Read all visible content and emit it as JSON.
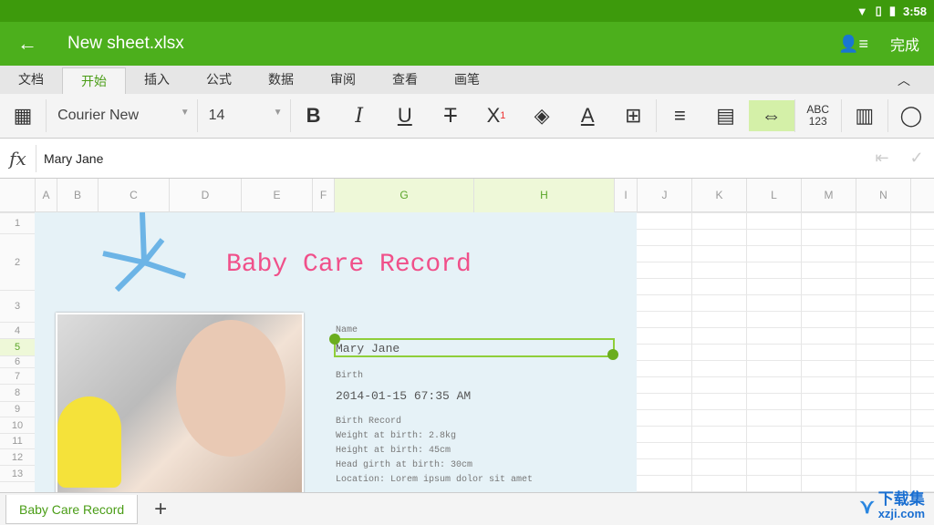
{
  "status": {
    "time": "3:58",
    "icons": [
      "wifi-icon",
      "no-sim-icon",
      "battery-icon"
    ]
  },
  "appbar": {
    "title": "New sheet.xlsx",
    "done_label": "完成",
    "share_icon": "share-user-icon",
    "back_icon": "arrow-left-icon"
  },
  "tabs": [
    {
      "label": "文档"
    },
    {
      "label": "开始",
      "active": true
    },
    {
      "label": "插入"
    },
    {
      "label": "公式"
    },
    {
      "label": "数据"
    },
    {
      "label": "审阅"
    },
    {
      "label": "查看"
    },
    {
      "label": "画笔"
    }
  ],
  "toolbar": {
    "font": "Courier New",
    "size": "14",
    "superscript": "1",
    "abc": "ABC",
    "num": "123"
  },
  "formula": {
    "label": "fx",
    "value": "Mary Jane"
  },
  "columns": [
    "A",
    "B",
    "C",
    "D",
    "E",
    "F",
    "G",
    "H",
    "I",
    "J",
    "K",
    "L",
    "M",
    "N"
  ],
  "rows": [
    "1",
    "2",
    "3",
    "4",
    "5",
    "6",
    "7",
    "8",
    "9",
    "10",
    "11",
    "12",
    "13"
  ],
  "sheet": {
    "title": "Baby Care Record",
    "name_label": "Name",
    "name": "Mary Jane",
    "birth_label": "Birth",
    "birth": "2014-01-15 67:35 AM",
    "record_label": "Birth Record",
    "weight": "Weight at birth: 2.8kg",
    "height": "Height at birth: 45cm",
    "head": "Head girth at birth: 30cm",
    "location": "Location: Lorem ipsum dolor sit amet"
  },
  "sheet_tabs": [
    {
      "label": "Baby Care Record"
    }
  ],
  "watermark": {
    "text": "下载集",
    "url": "xzji.com"
  },
  "colors": {
    "accent": "#4caf1c",
    "title": "#f0508a",
    "selection": "#8fce3a"
  }
}
